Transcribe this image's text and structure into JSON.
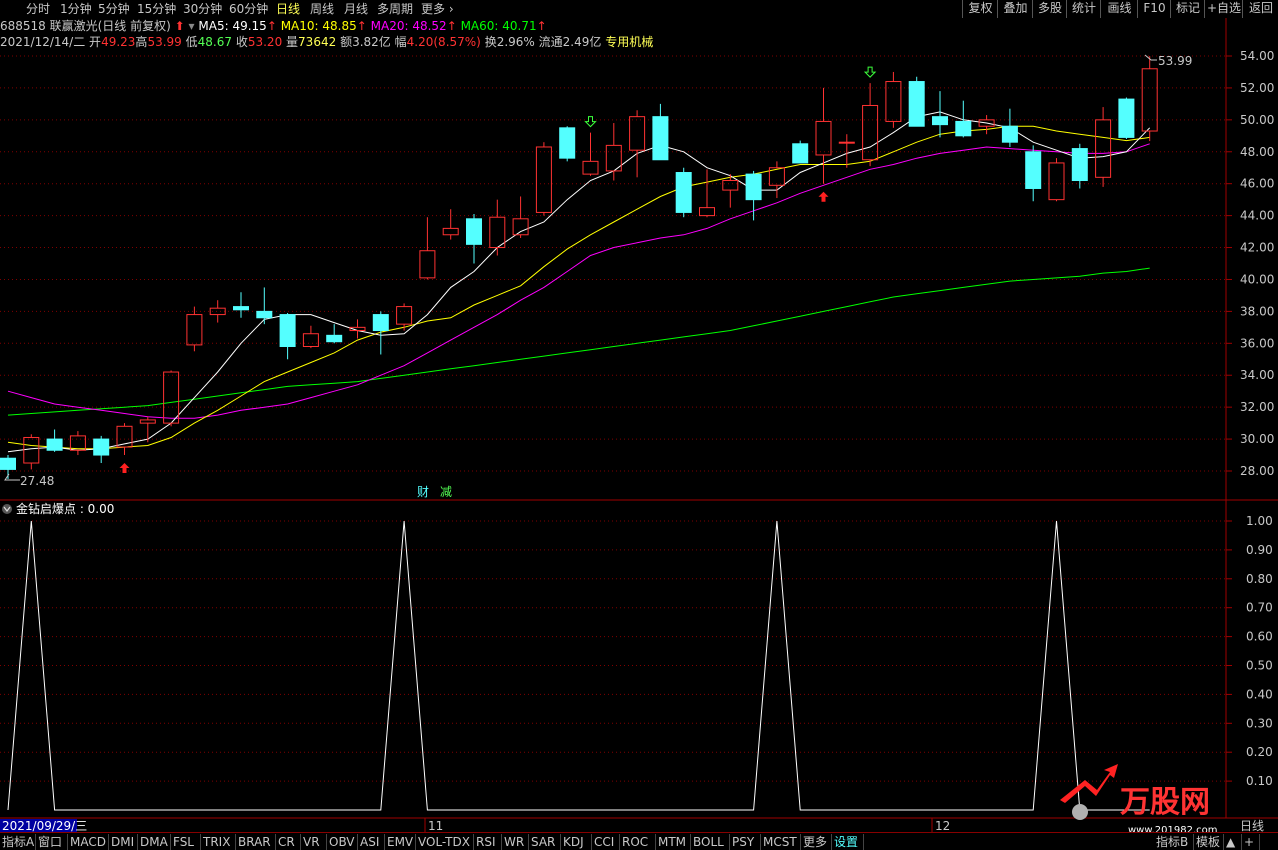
{
  "toolbar": {
    "periods": [
      "分时",
      "1分钟",
      "5分钟",
      "15分钟",
      "30分钟",
      "60分钟",
      "日线",
      "周线",
      "月线",
      "多周期",
      "更多"
    ],
    "active_period": "日线",
    "right_buttons": [
      "复权",
      "叠加",
      "多股",
      "统计",
      "画线",
      "F10",
      "标记",
      "+自选",
      "返回"
    ]
  },
  "header": {
    "code_name": "688518 联赢激光(日线 前复权)",
    "ma5_label": "MA5: 49.15",
    "ma10_label": "MA10: 48.85",
    "ma20_label": "MA20: 48.52",
    "ma60_label": "MA60: 40.71",
    "date": "2021/12/14/二",
    "open_label": "开",
    "open": "49.23",
    "high_label": "高",
    "high": "53.99",
    "low_label": "低",
    "low": "48.67",
    "close_label": "收",
    "close": "53.20",
    "volume_label": "量",
    "volume": "73642",
    "amount_label": "额",
    "amount": "3.82亿",
    "amp_label": "幅",
    "amp": "4.20(8.57%)",
    "turnover_label": "换",
    "turnover": "2.96%",
    "float_label": "流通",
    "float": "2.49亿",
    "sector": "专用机械"
  },
  "price_axis": {
    "ticks": [
      "54.00",
      "52.00",
      "50.00",
      "48.00",
      "46.00",
      "44.00",
      "42.00",
      "40.00",
      "38.00",
      "36.00",
      "34.00",
      "32.00",
      "30.00",
      "28.00"
    ],
    "max_marker": "53.99",
    "min_marker": "27.48"
  },
  "markers": {
    "cai": "财",
    "jian": "减"
  },
  "indicator": {
    "title": "金钻启爆点 : 0.00",
    "ticks": [
      "1.00",
      "0.90",
      "0.80",
      "0.70",
      "0.60",
      "0.50",
      "0.40",
      "0.30",
      "0.20",
      "0.10"
    ]
  },
  "date_axis": {
    "current_date": "2021/09/29/三",
    "month_11": "11",
    "month_12": "12",
    "right_label": "日线"
  },
  "indicator_tabs": [
    "指标A",
    "窗口",
    "MACD",
    "DMI",
    "DMA",
    "FSL",
    "TRIX",
    "BRAR",
    "CR",
    "VR",
    "OBV",
    "ASI",
    "EMV",
    "VOL-TDX",
    "RSI",
    "WR",
    "SAR",
    "KDJ",
    "CCI",
    "ROC",
    "MTM",
    "BOLL",
    "PSY",
    "MCST",
    "更多",
    "设置"
  ],
  "indicator_b": [
    "指标B",
    "模板",
    "▲",
    "+"
  ],
  "watermark": {
    "text": "万股网",
    "url": "www.201982.com"
  },
  "colors": {
    "up": "#ff3232",
    "down": "#54ffff",
    "ma5": "#ffffff",
    "ma10": "#ffff00",
    "ma20": "#ff00ff",
    "ma60": "#00ff00",
    "grid": "#800000",
    "accent": "#ffff55"
  },
  "chart_data": {
    "type": "candlestick",
    "ylim": [
      26.5,
      55.5
    ],
    "candles": [
      {
        "o": 28.8,
        "h": 29.0,
        "l": 27.5,
        "c": 28.1
      },
      {
        "o": 28.5,
        "h": 30.3,
        "l": 28.1,
        "c": 30.1
      },
      {
        "o": 30.0,
        "h": 30.6,
        "l": 29.2,
        "c": 29.3
      },
      {
        "o": 29.3,
        "h": 30.5,
        "l": 29.0,
        "c": 30.2
      },
      {
        "o": 30.0,
        "h": 30.2,
        "l": 28.5,
        "c": 29.0
      },
      {
        "o": 29.5,
        "h": 31.0,
        "l": 29.0,
        "c": 30.8
      },
      {
        "o": 31.0,
        "h": 31.4,
        "l": 29.8,
        "c": 31.2
      },
      {
        "o": 31.0,
        "h": 34.3,
        "l": 30.8,
        "c": 34.2
      },
      {
        "o": 35.9,
        "h": 38.3,
        "l": 35.5,
        "c": 37.8
      },
      {
        "o": 37.8,
        "h": 38.7,
        "l": 37.3,
        "c": 38.2
      },
      {
        "o": 38.3,
        "h": 39.2,
        "l": 37.6,
        "c": 38.1
      },
      {
        "o": 38.0,
        "h": 39.5,
        "l": 37.2,
        "c": 37.6
      },
      {
        "o": 37.8,
        "h": 37.9,
        "l": 35.0,
        "c": 35.8
      },
      {
        "o": 35.8,
        "h": 37.1,
        "l": 35.7,
        "c": 36.6
      },
      {
        "o": 36.5,
        "h": 37.2,
        "l": 36.0,
        "c": 36.1
      },
      {
        "o": 36.8,
        "h": 37.5,
        "l": 36.3,
        "c": 37.0
      },
      {
        "o": 37.8,
        "h": 38.0,
        "l": 35.3,
        "c": 36.8
      },
      {
        "o": 37.2,
        "h": 38.5,
        "l": 36.8,
        "c": 38.3
      },
      {
        "o": 40.1,
        "h": 43.9,
        "l": 40.0,
        "c": 41.8
      },
      {
        "o": 42.8,
        "h": 44.4,
        "l": 42.5,
        "c": 43.2
      },
      {
        "o": 43.8,
        "h": 44.1,
        "l": 41.0,
        "c": 42.2
      },
      {
        "o": 42.0,
        "h": 45.0,
        "l": 41.5,
        "c": 43.9
      },
      {
        "o": 42.8,
        "h": 45.2,
        "l": 42.6,
        "c": 43.8
      },
      {
        "o": 44.2,
        "h": 48.6,
        "l": 44.0,
        "c": 48.3
      },
      {
        "o": 49.5,
        "h": 49.6,
        "l": 47.4,
        "c": 47.6
      },
      {
        "o": 46.6,
        "h": 49.2,
        "l": 46.5,
        "c": 47.4
      },
      {
        "o": 46.8,
        "h": 49.8,
        "l": 46.2,
        "c": 48.4
      },
      {
        "o": 48.1,
        "h": 50.6,
        "l": 46.4,
        "c": 50.2
      },
      {
        "o": 50.2,
        "h": 51.0,
        "l": 47.5,
        "c": 47.5
      },
      {
        "o": 46.7,
        "h": 47.0,
        "l": 43.9,
        "c": 44.2
      },
      {
        "o": 44.0,
        "h": 46.9,
        "l": 43.9,
        "c": 44.5
      },
      {
        "o": 45.6,
        "h": 46.6,
        "l": 44.5,
        "c": 46.2
      },
      {
        "o": 46.6,
        "h": 46.8,
        "l": 43.7,
        "c": 45.0
      },
      {
        "o": 45.9,
        "h": 47.4,
        "l": 45.1,
        "c": 47.0
      },
      {
        "o": 48.5,
        "h": 48.7,
        "l": 47.3,
        "c": 47.3
      },
      {
        "o": 47.8,
        "h": 52.0,
        "l": 46.0,
        "c": 49.9
      },
      {
        "o": 48.6,
        "h": 49.1,
        "l": 47.0,
        "c": 48.6
      },
      {
        "o": 47.5,
        "h": 52.3,
        "l": 47.1,
        "c": 50.9
      },
      {
        "o": 49.9,
        "h": 53.0,
        "l": 49.5,
        "c": 52.4
      },
      {
        "o": 52.4,
        "h": 52.7,
        "l": 49.6,
        "c": 49.6
      },
      {
        "o": 50.2,
        "h": 51.8,
        "l": 48.9,
        "c": 49.7
      },
      {
        "o": 49.9,
        "h": 51.2,
        "l": 48.9,
        "c": 49.0
      },
      {
        "o": 49.6,
        "h": 50.3,
        "l": 49.1,
        "c": 50.0
      },
      {
        "o": 49.6,
        "h": 50.7,
        "l": 48.3,
        "c": 48.6
      },
      {
        "o": 48.0,
        "h": 48.4,
        "l": 44.9,
        "c": 45.7
      },
      {
        "o": 45.0,
        "h": 47.6,
        "l": 44.9,
        "c": 47.3
      },
      {
        "o": 48.2,
        "h": 48.5,
        "l": 45.7,
        "c": 46.2
      },
      {
        "o": 46.4,
        "h": 50.8,
        "l": 45.8,
        "c": 50.0
      },
      {
        "o": 51.3,
        "h": 51.4,
        "l": 48.8,
        "c": 48.9
      },
      {
        "o": 49.3,
        "h": 53.99,
        "l": 48.67,
        "c": 53.2
      }
    ],
    "ma5": [
      29.2,
      29.4,
      29.5,
      29.3,
      29.4,
      29.7,
      30.0,
      31.0,
      32.6,
      34.2,
      36.0,
      37.5,
      37.8,
      37.8,
      37.3,
      36.8,
      36.5,
      36.6,
      37.8,
      39.5,
      40.5,
      42.0,
      43.0,
      43.6,
      45.0,
      46.2,
      46.8,
      47.9,
      48.4,
      48.0,
      47.0,
      46.5,
      45.6,
      45.6,
      46.7,
      47.3,
      47.9,
      48.3,
      49.2,
      50.2,
      50.5,
      50.0,
      49.8,
      49.5,
      48.6,
      48.1,
      47.6,
      47.7,
      48.0,
      49.5
    ],
    "ma10": [
      29.8,
      29.6,
      29.5,
      29.4,
      29.4,
      29.5,
      29.6,
      30.1,
      31.0,
      31.8,
      32.7,
      33.6,
      34.2,
      34.8,
      35.4,
      36.2,
      36.7,
      37.0,
      37.4,
      37.6,
      38.4,
      39.0,
      39.6,
      40.8,
      41.9,
      42.8,
      43.6,
      44.4,
      45.2,
      45.8,
      46.1,
      46.4,
      46.6,
      46.9,
      47.2,
      47.2,
      47.2,
      47.4,
      48.0,
      48.6,
      49.1,
      49.3,
      49.4,
      49.6,
      49.6,
      49.3,
      49.1,
      48.9,
      48.7,
      48.9
    ],
    "ma20": [
      33.0,
      32.6,
      32.2,
      32.0,
      31.8,
      31.6,
      31.4,
      31.3,
      31.3,
      31.5,
      31.8,
      32.0,
      32.2,
      32.6,
      33.0,
      33.4,
      34.0,
      34.6,
      35.4,
      36.2,
      37.0,
      37.8,
      38.7,
      39.5,
      40.5,
      41.5,
      42.0,
      42.3,
      42.6,
      42.8,
      43.2,
      43.8,
      44.3,
      44.8,
      45.4,
      45.9,
      46.4,
      46.9,
      47.2,
      47.6,
      47.9,
      48.1,
      48.3,
      48.2,
      48.1,
      48.0,
      47.9,
      47.9,
      48.0,
      48.5
    ],
    "ma60": [
      31.5,
      31.6,
      31.7,
      31.8,
      31.9,
      32.0,
      32.1,
      32.3,
      32.5,
      32.7,
      32.9,
      33.1,
      33.3,
      33.4,
      33.5,
      33.6,
      33.8,
      34.0,
      34.2,
      34.4,
      34.6,
      34.8,
      35.0,
      35.2,
      35.4,
      35.6,
      35.8,
      36.0,
      36.2,
      36.4,
      36.6,
      36.8,
      37.1,
      37.4,
      37.7,
      38.0,
      38.3,
      38.6,
      38.9,
      39.1,
      39.3,
      39.5,
      39.7,
      39.9,
      40.0,
      40.1,
      40.2,
      40.4,
      40.5,
      40.71
    ],
    "indicator_peaks": [
      1,
      17,
      33,
      45
    ],
    "indicator_ylim": [
      0,
      1.05
    ],
    "up_arrows": [
      5,
      35
    ],
    "down_arrows": [
      25,
      37
    ]
  }
}
